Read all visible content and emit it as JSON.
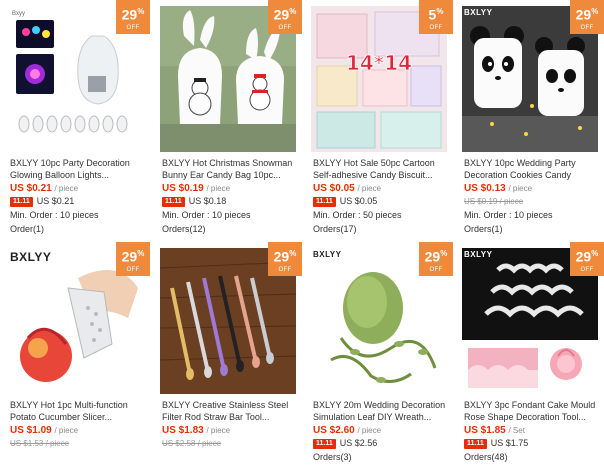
{
  "products": [
    {
      "discount": "29",
      "off": "OFF",
      "title": "BXLYY 10pc Party Decoration Glowing Balloon Lights...",
      "price": "US $0.21",
      "unit": "/ piece",
      "promo_tag": "11.11",
      "promo_price": "US $0.21",
      "promo_strike": false,
      "extra": "Min. Order : 10 pieces",
      "orders": "Order(1)",
      "brand": "Bxyy",
      "image": "balloon-lights-image"
    },
    {
      "discount": "29",
      "off": "OFF",
      "title": "BXLYY Hot Christmas Snowman Bunny Ear Candy Bag 10pc...",
      "price": "US $0.19",
      "unit": "/ piece",
      "promo_tag": "11.11",
      "promo_price": "US $0.18",
      "promo_strike": false,
      "extra": "Min. Order : 10 pieces",
      "orders": "Orders(12)",
      "brand": "",
      "image": "snowman-bunny-bag-image"
    },
    {
      "discount": "5",
      "off": "OFF",
      "title": "BXLYY Hot Sale 50pc Cartoon Self-adhesive Candy Biscuit...",
      "price": "US $0.05",
      "unit": "/ piece",
      "promo_tag": "11.11",
      "promo_price": "US $0.05",
      "promo_strike": false,
      "extra": "Min. Order : 50 pieces",
      "orders": "Orders(17)",
      "brand": "",
      "image_text": "14*14",
      "image": "self-adhesive-bags-image"
    },
    {
      "discount": "29",
      "off": "OFF",
      "title": "BXLYY 10pc Wedding Party Decoration Cookies Candy Bags...",
      "price": "US $0.13",
      "unit": "/ piece",
      "promo_tag": "",
      "promo_price": "US $0.19 / piece",
      "promo_strike": true,
      "extra": "Min. Order : 10 pieces",
      "orders": "Orders(1)",
      "brand": "BXLYY",
      "image": "panda-bags-image"
    },
    {
      "discount": "29",
      "off": "OFF",
      "title": "BXLYY Hot 1pc Multi-function Potato Cucumber Slicer...",
      "price": "US $1.09",
      "unit": "/ piece",
      "promo_tag": "",
      "promo_price": "US $1.53 / piece",
      "promo_strike": true,
      "extra": "",
      "orders": "",
      "brand": "BXLYY",
      "image": "slicer-image"
    },
    {
      "discount": "29",
      "off": "OFF",
      "title": "BXLYY Creative Stainless Steel Filter Rod Straw Bar Tool...",
      "price": "US $1.83",
      "unit": "/ piece",
      "promo_tag": "",
      "promo_price": "US $2.58 / piece",
      "promo_strike": true,
      "extra": "",
      "orders": "",
      "brand": "",
      "image": "straws-image"
    },
    {
      "discount": "29",
      "off": "OFF",
      "title": "BXLYY 20m Wedding Decoration Simulation Leaf DIY Wreath...",
      "price": "US $2.60",
      "unit": "/ piece",
      "promo_tag": "11.11",
      "promo_price": "US $2.56",
      "promo_strike": false,
      "extra": "",
      "orders": "Orders(3)",
      "brand": "BXLYY",
      "image": "leaf-vine-image"
    },
    {
      "discount": "29",
      "off": "OFF",
      "title": "BXLYY 3pc Fondant Cake Mould Rose Shape Decoration Tool...",
      "price": "US $1.85",
      "unit": "/ Set",
      "promo_tag": "11.11",
      "promo_price": "US $1.75",
      "promo_strike": false,
      "extra": "",
      "orders": "Orders(48)",
      "brand": "BXLYY",
      "image": "cake-mould-image"
    }
  ],
  "colors": {
    "badge": "#ef8a3c",
    "price": "#e62e04",
    "tag": "#e62e04"
  }
}
